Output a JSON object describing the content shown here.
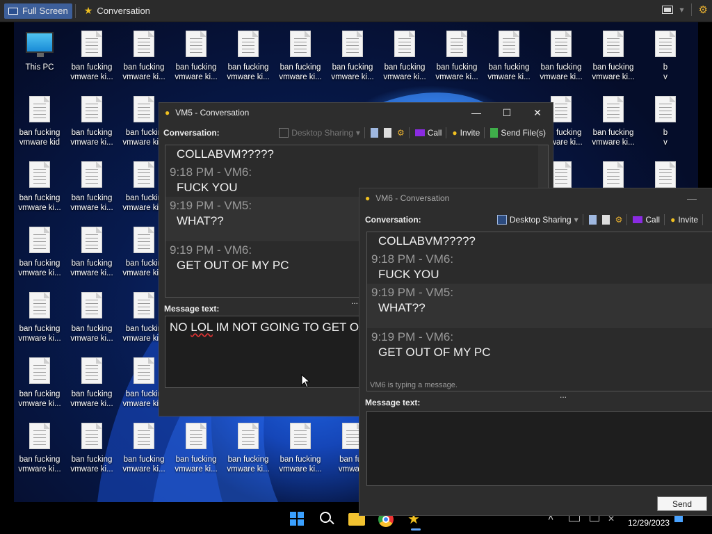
{
  "host_bar": {
    "full_screen_label": "Full Screen",
    "conversation_label": "Conversation"
  },
  "desktop": {
    "this_pc_label": "This PC",
    "file_label_line1": "ban fucking",
    "file_label_line2": "vmware ki...",
    "file_label_kid": "vmware kid",
    "truncated": {
      "bar": "ban fuckin",
      "b": "b",
      "v": "v",
      "banfuc": "ban fuc",
      "vmware": "vmware"
    }
  },
  "vm5_window": {
    "title": "VM5 - Conversation",
    "toolbar": {
      "label": "Conversation:",
      "desktop_sharing": "Desktop Sharing",
      "call": "Call",
      "invite": "Invite",
      "send_files": "Send File(s)"
    },
    "messages": [
      {
        "text": "COLLABVM?????"
      },
      {
        "who": "9:18 PM - VM6:",
        "text": "FUCK YOU"
      },
      {
        "who": "9:19 PM - VM5:",
        "text": "WHAT??"
      },
      {
        "who": "9:19 PM - VM6:",
        "text": "GET OUT OF MY PC"
      }
    ],
    "message_text_label": "Message text:",
    "message_input_prefix": "NO ",
    "message_input_lol": "LOL",
    "message_input_rest": " IM NOT GOING TO GET O",
    "splitter": "..."
  },
  "vm6_window": {
    "title": "VM6 - Conversation",
    "toolbar": {
      "label": "Conversation:",
      "desktop_sharing": "Desktop Sharing",
      "call": "Call",
      "invite": "Invite"
    },
    "messages": [
      {
        "text": "COLLABVM?????"
      },
      {
        "who": "9:18 PM - VM6:",
        "text": "FUCK YOU"
      },
      {
        "who": "9:19 PM - VM5:",
        "text": "WHAT??"
      },
      {
        "who": "9:19 PM - VM6:",
        "text": "GET OUT OF MY PC"
      }
    ],
    "typing_status": "VM6 is typing a message.",
    "message_text_label": "Message text:",
    "message_input": "",
    "send_label": "Send",
    "splitter": "..."
  },
  "taskbar": {
    "date": "12/29/2023"
  },
  "colors": {
    "accent": "#3d5f9a",
    "window_bg": "#2d2d2d",
    "input_bg": "#1e1e1e",
    "call_icon": "#8a2be2"
  }
}
